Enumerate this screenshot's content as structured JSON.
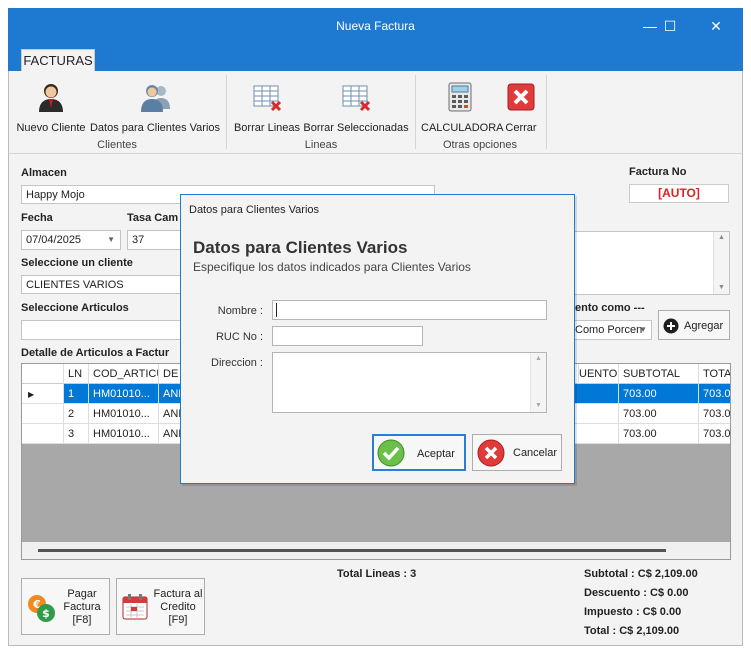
{
  "window": {
    "title": "Nueva Factura",
    "minimize_glyph": "—",
    "maximize_glyph": "☐",
    "close_glyph": "✕"
  },
  "ribbon": {
    "tab": "FACTURAS",
    "groups": [
      {
        "label": "Clientes",
        "buttons": [
          {
            "label": "Nuevo Cliente",
            "icon": "user-icon"
          },
          {
            "label": "Datos para Clientes Varios",
            "icon": "users-icon"
          }
        ]
      },
      {
        "label": "Lineas",
        "buttons": [
          {
            "label": "Borrar Lineas",
            "icon": "table-delete-icon"
          },
          {
            "label": "Borrar Seleccionadas",
            "icon": "table-delete-icon"
          }
        ]
      },
      {
        "label": "Otras opciones",
        "buttons": [
          {
            "label": "CALCULADORA",
            "icon": "calculator-icon"
          },
          {
            "label": "Cerrar",
            "icon": "close-icon"
          }
        ]
      }
    ]
  },
  "form": {
    "almacen_label": "Almacen",
    "almacen_value": "Happy Mojo",
    "factura_no_label": "Factura No",
    "factura_no_value": "[AUTO]",
    "fecha_label": "Fecha",
    "fecha_value": "07/04/2025",
    "tasa_label": "Tasa Cam",
    "tasa_value": "37",
    "cliente_label": "Seleccione un cliente",
    "cliente_value": "CLIENTES VARIOS",
    "articulos_label": "Seleccione Articulos",
    "descuento_label": "ento como ---",
    "descuento_value": "Como Porcen",
    "agregar_label": "Agregar",
    "detalle_label": "Detalle de Articulos a Factur"
  },
  "grid": {
    "columns": [
      "LN",
      "COD_ARTICU",
      "DE",
      "UENTO",
      "SUBTOTAL",
      "TOTA"
    ],
    "rows": [
      {
        "ln": "1",
        "cod": "HM01010...",
        "desc": "ANI",
        "subtotal": "703.00",
        "total": "703.0"
      },
      {
        "ln": "2",
        "cod": "HM01010...",
        "desc": "ANI",
        "subtotal": "703.00",
        "total": "703.0"
      },
      {
        "ln": "3",
        "cod": "HM01010...",
        "desc": "ANI",
        "subtotal": "703.00",
        "total": "703.0"
      }
    ]
  },
  "bottom": {
    "pagar_lines": [
      "Pagar",
      "Factura",
      "[F8]"
    ],
    "credito_lines": [
      "Factura al",
      "Credito",
      "[F9]"
    ],
    "total_lineas": "Total Lineas : 3",
    "subtotal": "Subtotal : C$ 2,109.00",
    "descuento": "Descuento : C$ 0.00",
    "impuesto": "Impuesto : C$ 0.00",
    "total": "Total : C$ 2,109.00"
  },
  "dialog": {
    "title": "Datos para Clientes Varios",
    "heading": "Datos para Clientes Varios",
    "subheading": "Especifique los datos indicados para Clientes Varios",
    "nombre_label": "Nombre :",
    "ruc_label": "RUC No :",
    "direccion_label": "Direccion :",
    "nombre_value": "",
    "ruc_value": "",
    "direccion_value": "",
    "aceptar_label": "Aceptar",
    "cancelar_label": "Cancelar"
  },
  "colors": {
    "accent": "#1e7ad1",
    "selection": "#0078d7",
    "auto_red": "#e02020"
  }
}
